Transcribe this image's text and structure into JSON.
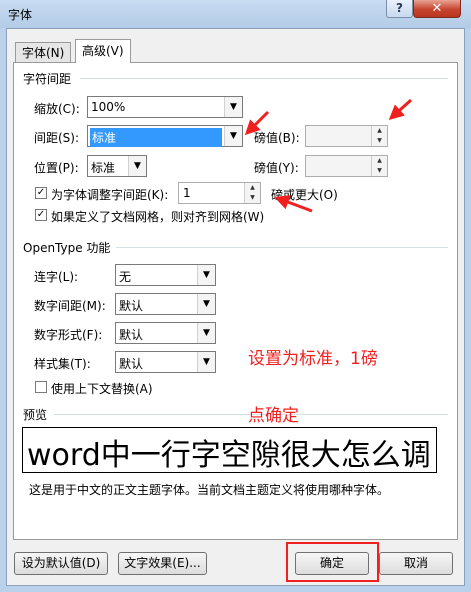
{
  "window": {
    "title": "字体",
    "help_label": "?",
    "close_label": "✕"
  },
  "tabs": [
    {
      "label": "字体(N)"
    },
    {
      "label": "高级(V)"
    }
  ],
  "spacing": {
    "group_title": "字符间距",
    "scale_label": "缩放(C):",
    "scale_value": "100%",
    "spacing_label": "间距(S):",
    "spacing_value": "标准",
    "by1_label": "磅值(B):",
    "by1_value": "",
    "position_label": "位置(P):",
    "position_value": "标准",
    "by2_label": "磅值(Y):",
    "by2_value": "",
    "kerning_label": "为字体调整字间距(K):",
    "kerning_checked": true,
    "kerning_value": "1",
    "kerning_suffix": "磅或更大(O)",
    "grid_label": "如果定义了文档网格，则对齐到网格(W)",
    "grid_checked": true
  },
  "opentype": {
    "group_title": "OpenType 功能",
    "ligatures_label": "连字(L):",
    "ligatures_value": "无",
    "num_spacing_label": "数字间距(M):",
    "num_spacing_value": "默认",
    "num_forms_label": "数字形式(F):",
    "num_forms_value": "默认",
    "stylistic_label": "样式集(T):",
    "stylistic_value": "默认",
    "contextual_label": "使用上下文替换(A)",
    "contextual_checked": false
  },
  "preview": {
    "group_title": "预览",
    "text": "word中一行字空隙很大怎么调",
    "description": "这是用于中文的正文主题字体。当前文档主题定义将使用哪种字体。"
  },
  "buttons": {
    "default_label": "设为默认值(D)",
    "effects_label": "文字效果(E)...",
    "ok_label": "确定",
    "cancel_label": "取消"
  },
  "annotations": {
    "note1": "设置为标准，1磅",
    "note2": "点确定",
    "color": "#f02020"
  }
}
